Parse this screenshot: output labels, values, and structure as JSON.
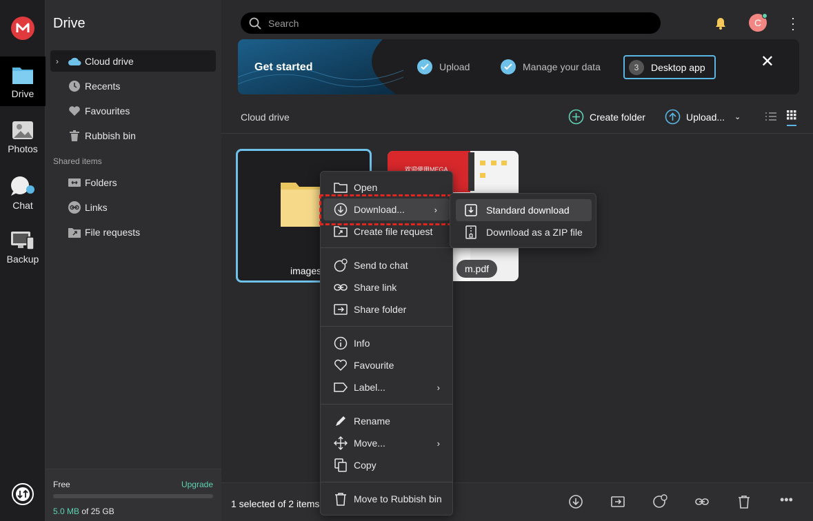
{
  "rail": {
    "items": [
      {
        "label": "Drive",
        "icon": "folder-icon"
      },
      {
        "label": "Photos",
        "icon": "photos-icon"
      },
      {
        "label": "Chat",
        "icon": "chat-icon"
      },
      {
        "label": "Backup",
        "icon": "backup-icon"
      }
    ]
  },
  "sidebar": {
    "title": "Drive",
    "items": [
      {
        "label": "Cloud drive"
      },
      {
        "label": "Recents"
      },
      {
        "label": "Favourites"
      },
      {
        "label": "Rubbish bin"
      }
    ],
    "shared_label": "Shared items",
    "shared": [
      {
        "label": "Folders"
      },
      {
        "label": "Links"
      },
      {
        "label": "File requests"
      }
    ],
    "quota": {
      "plan": "Free",
      "upgrade": "Upgrade",
      "used": "5.0 MB",
      "total": " of 25 GB",
      "used_fraction": 0.0002
    }
  },
  "header": {
    "search_placeholder": "Search",
    "avatar_initial": "C"
  },
  "banner": {
    "title": "Get started",
    "steps": [
      {
        "label": "Upload",
        "done": true
      },
      {
        "label": "Manage your data",
        "done": true
      },
      {
        "number": "3",
        "label": "Desktop app",
        "done": false
      }
    ]
  },
  "toolbar": {
    "breadcrumb": "Cloud drive",
    "create_folder": "Create folder",
    "upload": "Upload..."
  },
  "items": [
    {
      "name": "images",
      "type": "folder"
    },
    {
      "name": "m.pdf",
      "type": "pdf",
      "preview_text": "欢迎使用MEGA"
    }
  ],
  "footer": {
    "selection": "1 selected of 2 items"
  },
  "context_menu": {
    "items": [
      {
        "label": "Open"
      },
      {
        "label": "Download..."
      },
      {
        "label": "Create file request"
      },
      {
        "label": "Send to chat"
      },
      {
        "label": "Share link"
      },
      {
        "label": "Share folder"
      },
      {
        "label": "Info"
      },
      {
        "label": "Favourite"
      },
      {
        "label": "Label..."
      },
      {
        "label": "Rename"
      },
      {
        "label": "Move..."
      },
      {
        "label": "Copy"
      },
      {
        "label": "Move to Rubbish bin"
      }
    ],
    "submenu": [
      {
        "label": "Standard download"
      },
      {
        "label": "Download as a ZIP file"
      }
    ]
  },
  "colors": {
    "accent": "#6ec1e8",
    "brand": "#e03a3e",
    "upgrade": "#5fd2b0",
    "highlight_dash": "#e0261f"
  }
}
